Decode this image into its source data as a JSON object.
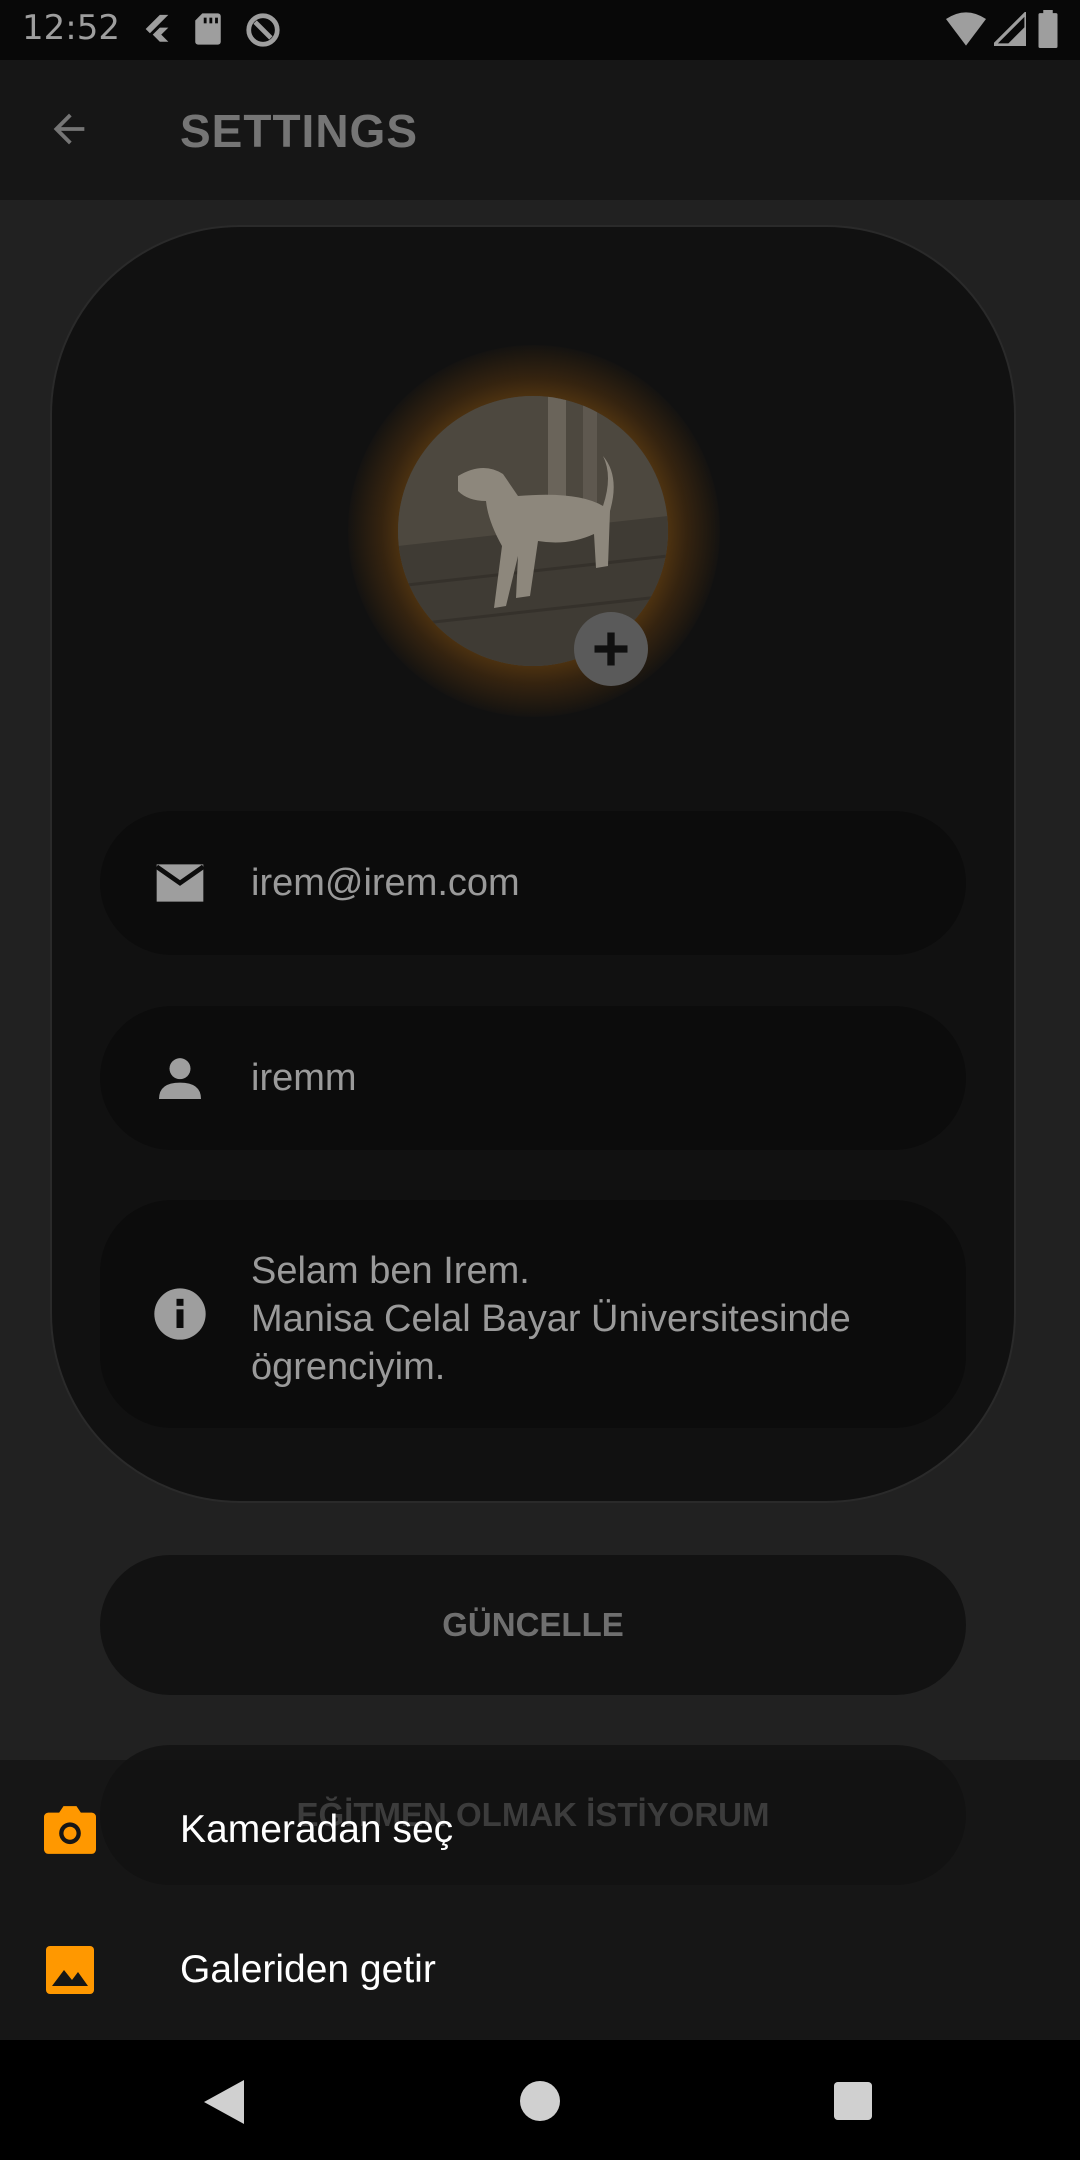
{
  "status_bar": {
    "time": "12:52",
    "icons": [
      "flutter-icon",
      "sd-card-icon",
      "do-not-disturb-icon",
      "wifi-icon",
      "signal-icon",
      "battery-icon"
    ]
  },
  "app_bar": {
    "title": "SETTINGS",
    "back_icon": "arrow-back-icon"
  },
  "profile": {
    "avatar_description_icon": "dog-photo",
    "add_photo_icon": "plus-icon",
    "email": "irem@irem.com",
    "username": "iremm",
    "bio_line1": "Selam ben Irem.",
    "bio_line2": "Manisa Celal Bayar Üniversitesinde",
    "bio_line3": "ögrenciyim."
  },
  "actions": {
    "update_label": "GÜNCELLE",
    "instructor_label": "EĞİTMEN OLMAK İSTİYORUM"
  },
  "bottom_sheet": {
    "camera_label": "Kameradan seç",
    "gallery_label": "Galeriden getir",
    "accent": "#FF9800"
  },
  "nav_bar": {
    "icons": [
      "back-triangle-icon",
      "home-circle-icon",
      "recents-square-icon"
    ]
  }
}
